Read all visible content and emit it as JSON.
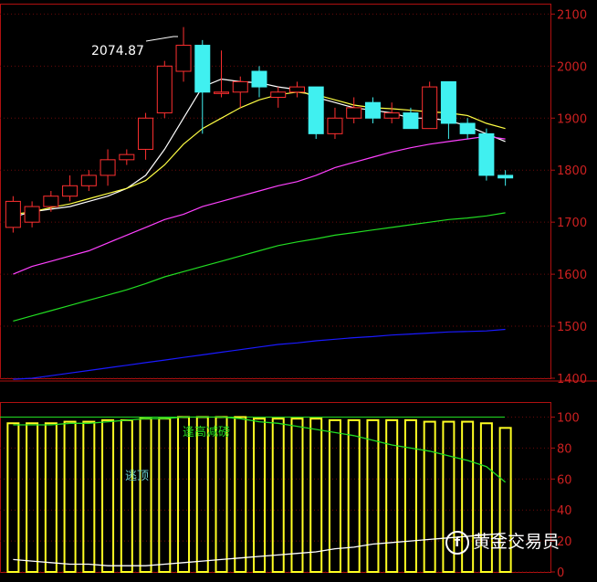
{
  "chart_data": [
    {
      "type": "candlestick",
      "title": "",
      "y_ticks": [
        1400,
        1500,
        1600,
        1700,
        1800,
        1900,
        2000,
        2100
      ],
      "ylim": [
        1400,
        2120
      ],
      "annotation": "2074.87",
      "candles": [
        {
          "o": 1690,
          "h": 1750,
          "l": 1680,
          "c": 1740
        },
        {
          "o": 1700,
          "h": 1740,
          "l": 1690,
          "c": 1730
        },
        {
          "o": 1730,
          "h": 1760,
          "l": 1720,
          "c": 1750
        },
        {
          "o": 1750,
          "h": 1790,
          "l": 1740,
          "c": 1770
        },
        {
          "o": 1770,
          "h": 1800,
          "l": 1760,
          "c": 1790
        },
        {
          "o": 1790,
          "h": 1840,
          "l": 1770,
          "c": 1820
        },
        {
          "o": 1820,
          "h": 1840,
          "l": 1810,
          "c": 1830
        },
        {
          "o": 1840,
          "h": 1910,
          "l": 1820,
          "c": 1900
        },
        {
          "o": 1910,
          "h": 2010,
          "l": 1900,
          "c": 2000
        },
        {
          "o": 1990,
          "h": 2075,
          "l": 1970,
          "c": 2040
        },
        {
          "o": 2040,
          "h": 2050,
          "l": 1870,
          "c": 1950
        },
        {
          "o": 1950,
          "h": 2030,
          "l": 1940,
          "c": 1950
        },
        {
          "o": 1950,
          "h": 1980,
          "l": 1920,
          "c": 1970
        },
        {
          "o": 1990,
          "h": 2000,
          "l": 1940,
          "c": 1960
        },
        {
          "o": 1940,
          "h": 1960,
          "l": 1920,
          "c": 1950
        },
        {
          "o": 1950,
          "h": 1970,
          "l": 1940,
          "c": 1960
        },
        {
          "o": 1960,
          "h": 1960,
          "l": 1860,
          "c": 1870
        },
        {
          "o": 1870,
          "h": 1920,
          "l": 1860,
          "c": 1900
        },
        {
          "o": 1900,
          "h": 1940,
          "l": 1890,
          "c": 1920
        },
        {
          "o": 1930,
          "h": 1940,
          "l": 1890,
          "c": 1900
        },
        {
          "o": 1900,
          "h": 1930,
          "l": 1890,
          "c": 1910
        },
        {
          "o": 1910,
          "h": 1920,
          "l": 1880,
          "c": 1880
        },
        {
          "o": 1880,
          "h": 1970,
          "l": 1880,
          "c": 1960
        },
        {
          "o": 1970,
          "h": 1970,
          "l": 1860,
          "c": 1890
        },
        {
          "o": 1890,
          "h": 1900,
          "l": 1860,
          "c": 1870
        },
        {
          "o": 1870,
          "h": 1880,
          "l": 1780,
          "c": 1790
        },
        {
          "o": 1790,
          "h": 1800,
          "l": 1770,
          "c": 1785
        }
      ],
      "series": [
        {
          "color": "#ffffff",
          "values": [
            1710,
            1720,
            1725,
            1730,
            1740,
            1750,
            1765,
            1790,
            1840,
            1900,
            1960,
            1975,
            1970,
            1968,
            1960,
            1955,
            1940,
            1930,
            1920,
            1915,
            1910,
            1900,
            1900,
            1895,
            1885,
            1870,
            1855
          ]
        },
        {
          "color": "#ffff44",
          "values": [
            1715,
            1720,
            1728,
            1735,
            1745,
            1755,
            1765,
            1780,
            1810,
            1850,
            1880,
            1900,
            1920,
            1935,
            1945,
            1950,
            1945,
            1935,
            1925,
            1920,
            1918,
            1915,
            1912,
            1910,
            1905,
            1890,
            1880
          ]
        },
        {
          "color": "#ff40ff",
          "values": [
            1600,
            1615,
            1625,
            1635,
            1645,
            1660,
            1675,
            1690,
            1705,
            1715,
            1730,
            1740,
            1750,
            1760,
            1770,
            1778,
            1790,
            1805,
            1815,
            1825,
            1835,
            1843,
            1850,
            1855,
            1860,
            1865,
            1860
          ]
        },
        {
          "color": "#22dd22",
          "values": [
            1510,
            1520,
            1530,
            1540,
            1550,
            1560,
            1570,
            1582,
            1595,
            1605,
            1615,
            1625,
            1635,
            1645,
            1655,
            1662,
            1668,
            1675,
            1680,
            1685,
            1690,
            1695,
            1700,
            1705,
            1708,
            1712,
            1718
          ]
        },
        {
          "color": "#1a1aff",
          "values": [
            1398,
            1400,
            1405,
            1410,
            1415,
            1420,
            1425,
            1430,
            1435,
            1440,
            1445,
            1450,
            1455,
            1460,
            1465,
            1468,
            1472,
            1475,
            1478,
            1480,
            1483,
            1485,
            1487,
            1489,
            1490,
            1491,
            1494
          ]
        }
      ]
    },
    {
      "type": "bar",
      "y_ticks": [
        0,
        20,
        40,
        60,
        80,
        100
      ],
      "ylim": [
        0,
        105
      ],
      "annotations": [
        "逢高减磅",
        "逃顶"
      ],
      "values": [
        96,
        96,
        96,
        97,
        97,
        98,
        98,
        99,
        99,
        100,
        100,
        100,
        100,
        99,
        99,
        99,
        99,
        98,
        98,
        98,
        98,
        98,
        97,
        97,
        97,
        96,
        93
      ],
      "series": [
        {
          "color": "#22dd22",
          "values": [
            95,
            95,
            95,
            96,
            96,
            97,
            98,
            99,
            99,
            100,
            100,
            100,
            99,
            97,
            96,
            94,
            92,
            90,
            88,
            85,
            82,
            80,
            78,
            75,
            72,
            68,
            58
          ]
        },
        {
          "color": "#ffffff",
          "values": [
            8,
            7,
            6,
            5,
            5,
            4,
            4,
            4,
            5,
            6,
            7,
            8,
            9,
            10,
            11,
            12,
            13,
            15,
            16,
            18,
            19,
            20,
            21,
            22,
            23,
            24,
            25
          ]
        }
      ]
    }
  ],
  "watermark": "黄金交易员"
}
